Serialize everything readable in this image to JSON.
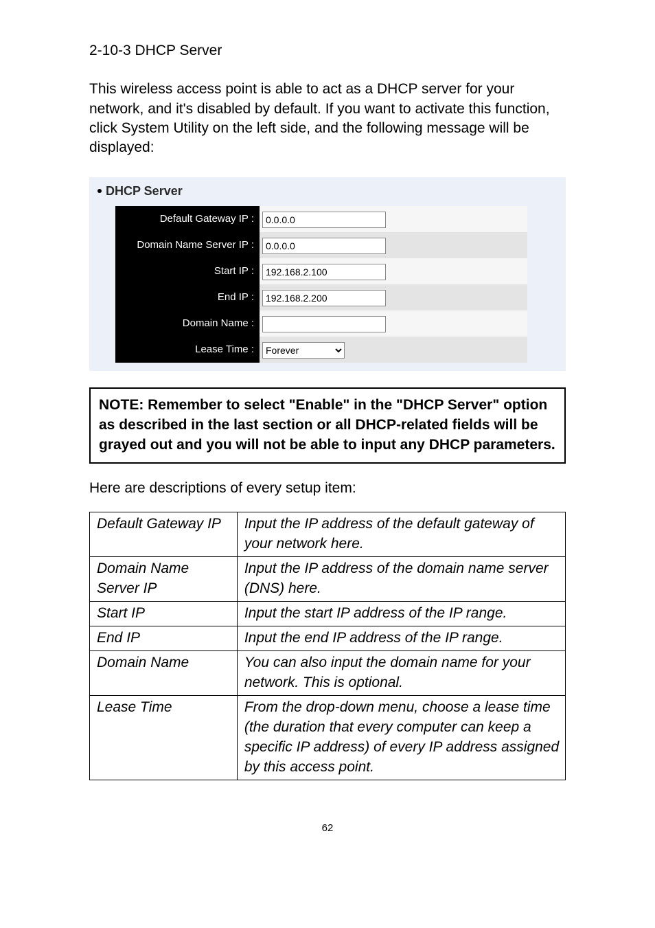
{
  "section_title": "2-10-3 DHCP Server",
  "intro_paragraph": "This wireless access point is able to act as a DHCP server for your network, and it's disabled by default. If you want to activate this function, click System Utility on the left side, and the following message will be displayed:",
  "dhcp_panel": {
    "header": "DHCP Server",
    "rows": [
      {
        "label": "Default Gateway IP :",
        "value": "0.0.0.0",
        "type": "text"
      },
      {
        "label": "Domain Name Server IP :",
        "value": "0.0.0.0",
        "type": "text"
      },
      {
        "label": "Start IP :",
        "value": "192.168.2.100",
        "type": "text"
      },
      {
        "label": "End IP :",
        "value": "192.168.2.200",
        "type": "text"
      },
      {
        "label": "Domain Name :",
        "value": "",
        "type": "text"
      },
      {
        "label": "Lease Time :",
        "value": "Forever",
        "type": "select"
      }
    ]
  },
  "note_text": "NOTE: Remember to select \"Enable\" in the \"DHCP Server\" option as described in the last section or all DHCP-related fields will be grayed out and you will not be able to input any DHCP parameters.",
  "desc_intro": "Here are descriptions of every setup item:",
  "desc_table": [
    {
      "left": "Default Gateway IP",
      "right": "Input the IP address of the default gateway of your network here."
    },
    {
      "left": "Domain Name Server IP",
      "right": "Input the IP address of the domain name server (DNS) here."
    },
    {
      "left": "Start IP",
      "right": "Input the start IP address of the IP range."
    },
    {
      "left": "End IP",
      "right": "Input the end IP address of the IP range."
    },
    {
      "left": "Domain Name",
      "right": "You can also input the domain name for your network. This is optional."
    },
    {
      "left": "Lease Time",
      "right": "From the drop-down menu, choose a lease time (the duration that every computer can keep a specific IP address) of every IP address assigned by this access point."
    }
  ],
  "page_number": "62"
}
